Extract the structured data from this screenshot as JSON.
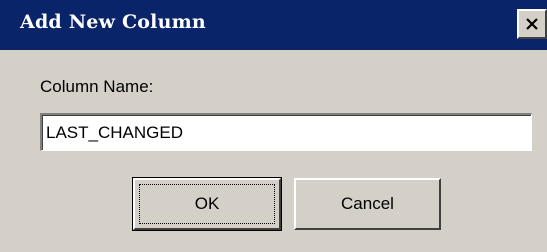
{
  "dialog": {
    "title": "Add New Column",
    "close_icon": "close-x-icon",
    "column_name_label": "Column Name:",
    "column_name_value": "LAST_CHANGED",
    "ok_label": "OK",
    "cancel_label": "Cancel"
  },
  "colors": {
    "titlebar": "#0a246a",
    "face": "#d4d0c8",
    "field": "#ffffff"
  }
}
